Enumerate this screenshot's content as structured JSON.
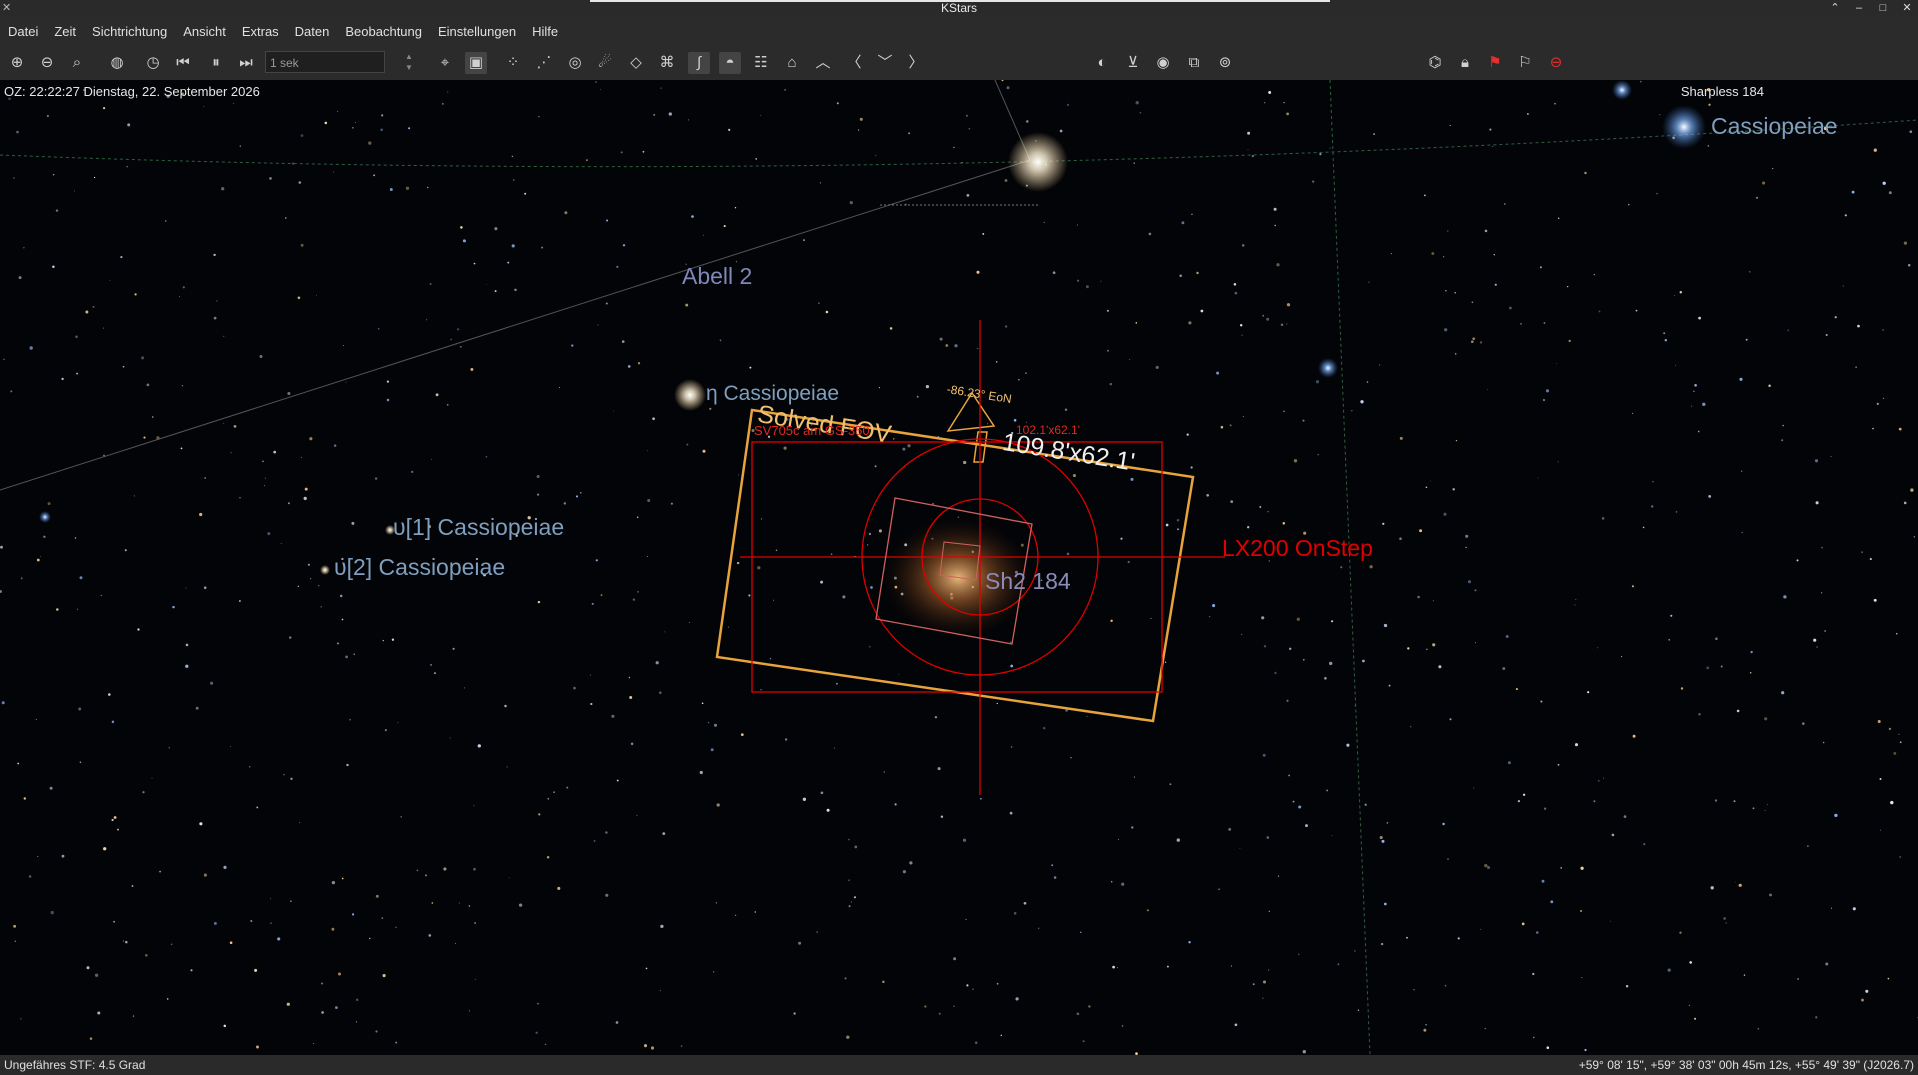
{
  "window": {
    "title": "KStars"
  },
  "menu": [
    "Datei",
    "Zeit",
    "Sichtrichtung",
    "Ansicht",
    "Extras",
    "Daten",
    "Beobachtung",
    "Einstellungen",
    "Hilfe"
  ],
  "toolbar": {
    "time_step": "1 sek",
    "icons": [
      "zoom-in-icon",
      "zoom-out-icon",
      "search-icon",
      "globe-icon",
      "clock-icon",
      "skip-back-icon",
      "pause-icon",
      "skip-forward-icon",
      "target-icon",
      "image-view-icon",
      "stars-icon",
      "constellation-icon",
      "deep-sky-icon",
      "comet-icon",
      "asteroid-icon",
      "satellite-icon",
      "milky-way-icon",
      "horizon-icon",
      "grid-icon",
      "home-icon",
      "up-icon",
      "left-icon",
      "down-icon",
      "right-icon",
      "ekos-icon",
      "telescope-icon",
      "observation-icon",
      "fov-icon",
      "zoom-fit-icon",
      "house-icon",
      "lock-icon",
      "flag-red-icon",
      "flag-gray-icon",
      "stop-icon"
    ]
  },
  "sky": {
    "time_info": "OZ: 22:22:27   Dienstag, 22. September 2026",
    "focused_object": "Sharpless 184",
    "labels": {
      "abell": "Abell 2",
      "eta_cas": "η Cassiopeiae",
      "upsilon1": "υ[1] Cassiopeiae",
      "upsilon2": "υ[2] Cassiopeiae",
      "cassiopeiae_top": "Cassiopeiae",
      "sh2": "Sh2 184",
      "telescope": "LX200 OnStep",
      "solved_fov": "Solved FOV",
      "fov_size": "109.8'x62.1'",
      "camera": "SV705c am GS-350",
      "small_fov": "102.1'x62.1'",
      "orientation": "-86.23° EoN"
    },
    "colors": {
      "fov": "#e8a43c",
      "telescope": "#e00000",
      "labels": "#7f9fbf"
    }
  },
  "status": {
    "left": "Ungefähres STF: 4.5 Grad",
    "right": "+59° 08' 15\", +59° 38' 03\" 00h 45m 12s, +55° 49' 39\" (J2026.7)"
  }
}
